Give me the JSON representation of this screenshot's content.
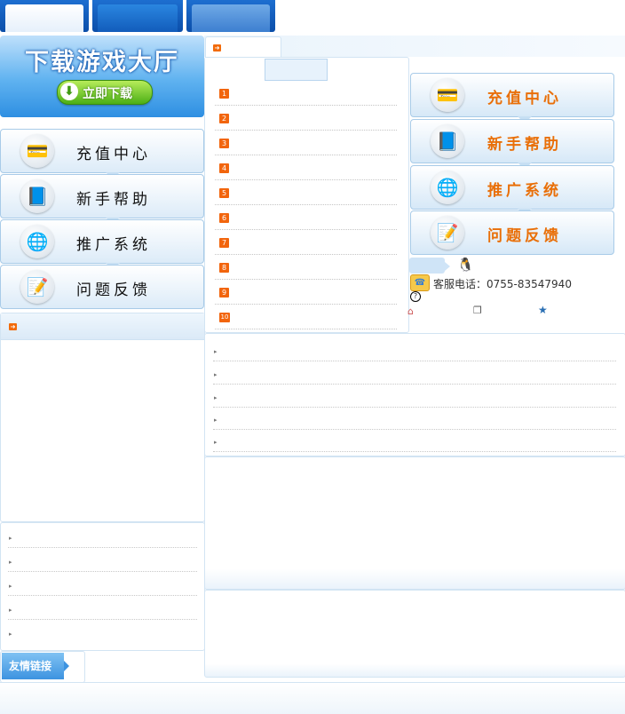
{
  "banner": {
    "title": "下载游戏大厅",
    "download_label": "立即下载"
  },
  "left_menu": [
    {
      "label": "充值中心",
      "icon": "coins-card-icon"
    },
    {
      "label": "新手帮助",
      "icon": "book-icon"
    },
    {
      "label": "推广系统",
      "icon": "globe-icon"
    },
    {
      "label": "问题反馈",
      "icon": "notepad-icon"
    }
  ],
  "right_menu": [
    {
      "label": "充值中心",
      "icon": "coins-card-icon"
    },
    {
      "label": "新手帮助",
      "icon": "book-icon"
    },
    {
      "label": "推广系统",
      "icon": "globe-icon"
    },
    {
      "label": "问题反馈",
      "icon": "notepad-icon"
    }
  ],
  "ranking": [
    "1",
    "2",
    "3",
    "4",
    "5",
    "6",
    "7",
    "8",
    "9",
    "10"
  ],
  "service": {
    "phone_label": "客服电话：0755-83547940"
  },
  "friend_links": {
    "label": "友情链接"
  },
  "colors": {
    "accent_orange": "#e96f08",
    "brand_blue": "#1d6ed0"
  }
}
